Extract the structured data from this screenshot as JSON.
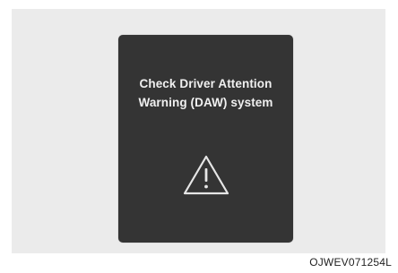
{
  "display": {
    "message_line1": "Check Driver Attention",
    "message_line2": "Warning (DAW) system",
    "icon": "warning-triangle-icon",
    "background_color": "#343434",
    "text_color": "#f0f0f0"
  },
  "figure": {
    "code": "OJWEV071254L"
  }
}
